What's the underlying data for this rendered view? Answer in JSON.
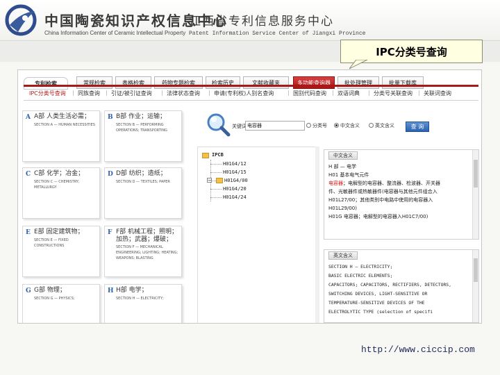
{
  "banner": {
    "org_cn": "中国陶瓷知识产权信息中心",
    "org_en": "China Information Center of Ceramic Intellectual Property",
    "org2_cn": "江西省专利信息服务中心",
    "org2_en": "Patent Information Service Center of Jiangxi Province"
  },
  "callout": {
    "label": "IPC分类号查询"
  },
  "nav": {
    "home": "专利检索",
    "tabs": [
      "常规检索",
      "表格检索",
      "药物专题检索",
      "检索历史",
      "文献收藏夹",
      "多功能查询器",
      "批处理管理",
      "批量下载库"
    ],
    "active_index": 5
  },
  "subnav": {
    "items": [
      "IPC分类号查询",
      "同族查询",
      "引证/被引证查询",
      "法律状态查询",
      "申请(专利权)人别名查询",
      "国别代码查询",
      "双语词典",
      "分类号关联查询",
      "关联词查询"
    ],
    "active_index": 0
  },
  "categories": [
    {
      "letter": "A",
      "title": "A部 人类生活必需；",
      "en": "SECTION A — HUMAN NECESSITIES"
    },
    {
      "letter": "B",
      "title": "B部 作业；运输；",
      "en": "SECTION B — PERFORMING OPERATIONS; TRANSPORTING"
    },
    {
      "letter": "C",
      "title": "C部 化学；冶金；",
      "en": "SECTION C — CHEMISTRY; METALLURGY"
    },
    {
      "letter": "D",
      "title": "D部 纺织；造纸；",
      "en": "SECTION D — TEXTILES; PAPER"
    },
    {
      "letter": "E",
      "title": "E部 固定建筑物；",
      "en": "SECTION E — FIXED CONSTRUCTIONS"
    },
    {
      "letter": "F",
      "title": "F部 机械工程；照明；加热；武器；爆破；",
      "en": "SECTION F — MECHANICAL ENGINEERING; LIGHTING; HEATING; WEAPONS; BLASTING"
    },
    {
      "letter": "G",
      "title": "G部 物理；",
      "en": "SECTION G — PHYSICS;"
    },
    {
      "letter": "H",
      "title": "H部 电学；",
      "en": "SECTION H — ELECTRICITY;"
    }
  ],
  "search": {
    "label": "关键词：",
    "value": "电容器",
    "options": [
      "分类号",
      "中文含义",
      "英文含义"
    ],
    "selected": 1,
    "button": "查 询"
  },
  "tree": {
    "root": "IPCB",
    "items": [
      "H01G4/12",
      "H01G4/15",
      "H01G4/00",
      "H01G4/20",
      "H01G4/24"
    ]
  },
  "def_cn": {
    "head": "中文含义",
    "lines": [
      {
        "t": "H 部 — 电学"
      },
      {
        "t": "H01 基本电气元件"
      },
      {
        "t": "电容器",
        "hl": true,
        "rest": "；电解型的电容器、整流器、检波器、开关器"
      },
      {
        "t": "件、光敏器件或热敏器件(电容器与其他元件组合入"
      },
      {
        "t": "H01L27/00；其他类别中电路中使用的电容器入"
      },
      {
        "t": "H01L29/00)"
      },
      {
        "t": "H01G 电容器；电解型的电容器入H01C7/00)"
      }
    ]
  },
  "def_en": {
    "head": "英文含义",
    "lines": [
      "SECTION H — ELECTRICITY;",
      "BASIC ELECTRIC ELEMENTS;",
      "CAPACITORS; CAPACITORS, RECTIFIERS, DETECTORS,",
      "SWITCHING DEVICES, LIGHT-SENSITIVE OR",
      "TEMPERATURE-SENSITIVE DEVICES OF THE",
      "ELECTROLYTIC TYPE (selection of specifi"
    ]
  },
  "url": "http://www.ciccip.com"
}
